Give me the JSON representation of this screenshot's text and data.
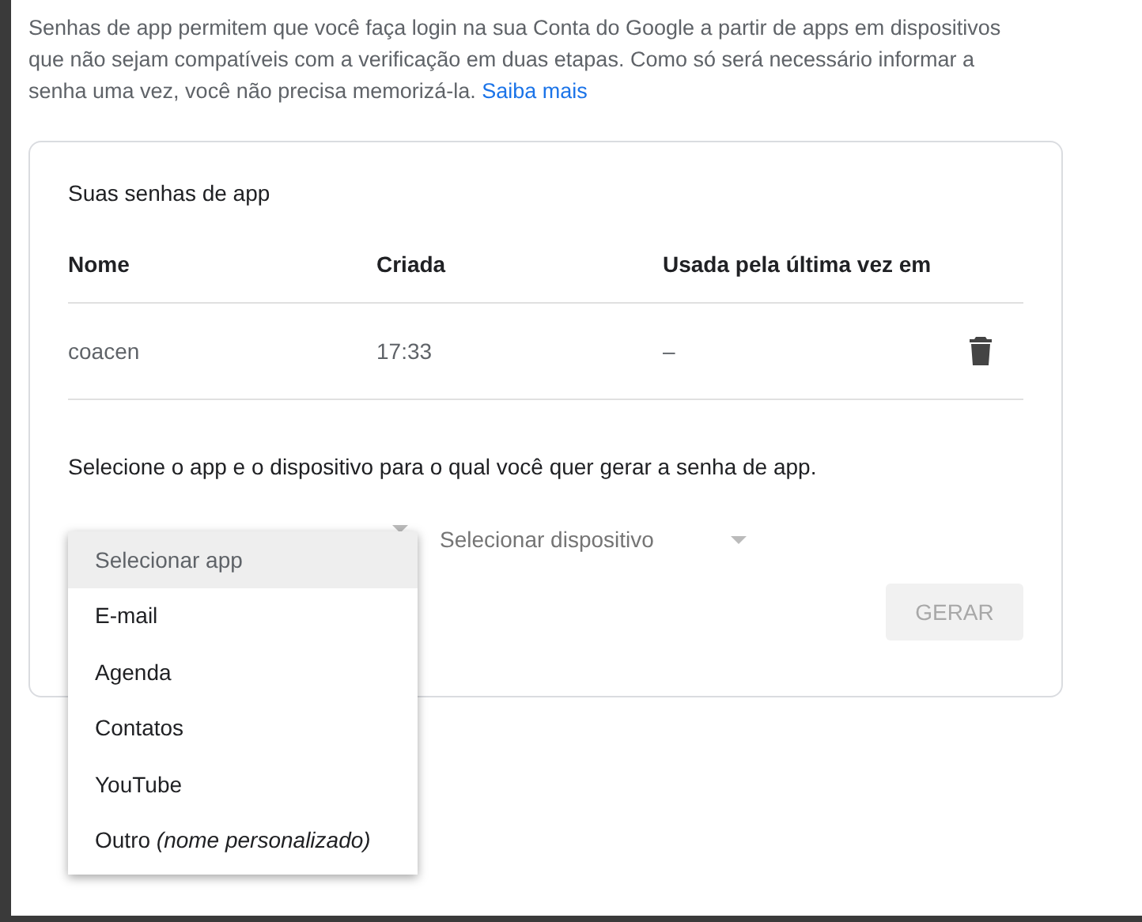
{
  "intro": {
    "text": "Senhas de app permitem que você faça login na sua Conta do Google a partir de apps em dispositivos que não sejam compatíveis com a verificação em duas etapas. Como só será necessário informar a senha uma vez, você não precisa memorizá-la.",
    "link": "Saiba mais"
  },
  "card": {
    "title": "Suas senhas de app",
    "columns": [
      "Nome",
      "Criada",
      "Usada pela última vez em"
    ],
    "rows": [
      {
        "name": "coacen",
        "created": "17:33",
        "last_used": "–"
      }
    ],
    "prompt": "Selecione o app e o dispositivo para o qual você quer gerar a senha de app.",
    "app_select": {
      "open": true,
      "options": [
        {
          "label": "Selecionar app",
          "selected": true
        },
        {
          "label": "E-mail",
          "selected": false
        },
        {
          "label": "Agenda",
          "selected": false
        },
        {
          "label": "Contatos",
          "selected": false
        },
        {
          "label": "YouTube",
          "selected": false
        },
        {
          "label": "Outro *(nome personalizado)*",
          "selected": false
        }
      ]
    },
    "device_select": {
      "placeholder": "Selecionar dispositivo"
    },
    "generate_button": {
      "label": "GERAR",
      "disabled": true
    }
  }
}
